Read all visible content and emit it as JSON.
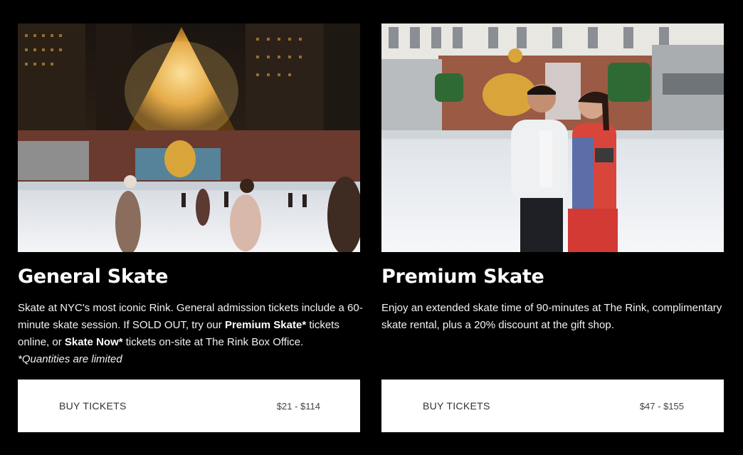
{
  "cards": [
    {
      "title": "General Skate",
      "desc": {
        "p1": "Skate at NYC's most iconic Rink. General admission tickets include a 60-minute skate session. If SOLD OUT, try our ",
        "b1": "Premium Skate*",
        "p2": " tickets online, or ",
        "b2": "Skate Now*",
        "p3": " tickets on-site at The Rink Box Office.",
        "note": "*Quantities are limited"
      },
      "button_label": "BUY TICKETS",
      "price": "$21 - $114"
    },
    {
      "title": "Premium Skate",
      "desc": {
        "p1": "Enjoy an extended skate time of 90-minutes at The Rink, complimentary skate rental, plus a 20% discount at the gift shop."
      },
      "button_label": "BUY TICKETS",
      "price": "$47 - $155"
    }
  ],
  "colors": {
    "background": "#000000",
    "button_bg": "#ffffff",
    "button_text": "#333333"
  }
}
